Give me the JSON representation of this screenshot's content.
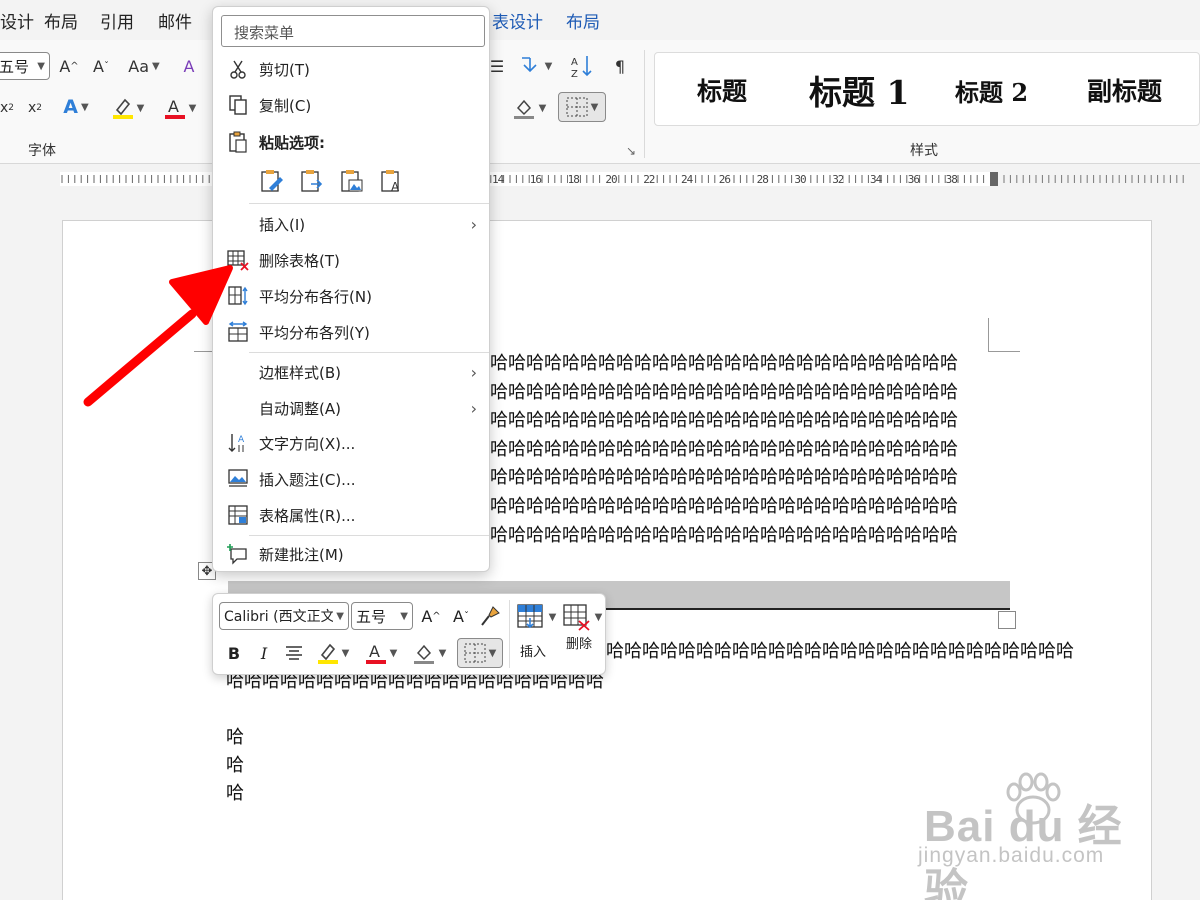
{
  "tabs": {
    "design": "设计",
    "layout": "布局",
    "references": "引用",
    "mailings": "邮件",
    "table_design": "表设计",
    "table_layout": "布局"
  },
  "ribbon": {
    "font_size_value": "五号",
    "font_group_label": "字体",
    "styles_group_label": "样式",
    "styles": [
      "标题",
      "标题 1",
      "标题 2",
      "副标题"
    ]
  },
  "ruler": {
    "numbers": [
      "14",
      "16",
      "18",
      "20",
      "22",
      "24",
      "26",
      "28",
      "30",
      "32",
      "34",
      "36",
      "38"
    ]
  },
  "context_menu": {
    "search_placeholder": "搜索菜单",
    "items": {
      "cut": "剪切(T)",
      "copy": "复制(C)",
      "paste_options": "粘贴选项:",
      "insert": "插入(I)",
      "delete_table": "删除表格(T)",
      "distribute_rows": "平均分布各行(N)",
      "distribute_columns": "平均分布各列(Y)",
      "border_styles": "边框样式(B)",
      "autofit": "自动调整(A)",
      "text_direction": "文字方向(X)...",
      "insert_caption": "插入题注(C)...",
      "table_properties": "表格属性(R)...",
      "new_comment": "新建批注(M)"
    }
  },
  "mini_toolbar": {
    "font_name": "Calibri (西文正文",
    "font_size": "五号",
    "insert_label": "插入",
    "delete_label": "删除"
  },
  "document": {
    "lines_upper": [
      "哈哈哈哈哈哈哈哈哈哈哈哈哈哈哈哈哈哈哈哈哈哈哈哈哈哈",
      "哈哈哈哈哈哈哈哈哈哈哈哈哈哈哈哈哈哈哈哈哈哈哈哈哈哈",
      "哈哈哈哈哈哈哈哈哈哈哈哈哈哈哈哈哈哈哈哈哈哈哈哈哈哈",
      "哈哈哈哈哈哈哈哈哈哈哈哈哈哈哈哈哈哈哈哈哈哈哈哈哈哈",
      "哈哈哈哈哈哈哈哈哈哈哈哈哈哈哈哈哈哈哈哈哈哈哈哈哈哈",
      "哈哈哈哈哈哈哈哈哈哈哈哈哈哈哈哈哈哈哈哈哈哈哈哈哈哈",
      "哈哈哈哈哈哈哈哈哈哈哈哈哈哈哈哈哈哈哈哈哈哈哈哈哈哈"
    ],
    "line_after_table_1": "哈哈哈哈哈哈哈哈哈哈哈哈哈哈哈哈哈哈哈哈哈哈哈哈哈哈",
    "line_after_table_2": "哈哈哈哈哈哈哈哈哈哈哈哈哈哈哈哈哈哈哈哈哈",
    "single_lines": [
      "哈",
      "哈",
      "哈"
    ]
  },
  "watermark": {
    "main": "Bai du 经验",
    "sub": "jingyan.baidu.com"
  },
  "colors": {
    "accent_blue": "#1e5bb5",
    "arrow_red": "#ff0000",
    "highlight_yellow": "#ffe600",
    "font_red": "#e81123",
    "selection_gray": "#c6c6c6"
  }
}
